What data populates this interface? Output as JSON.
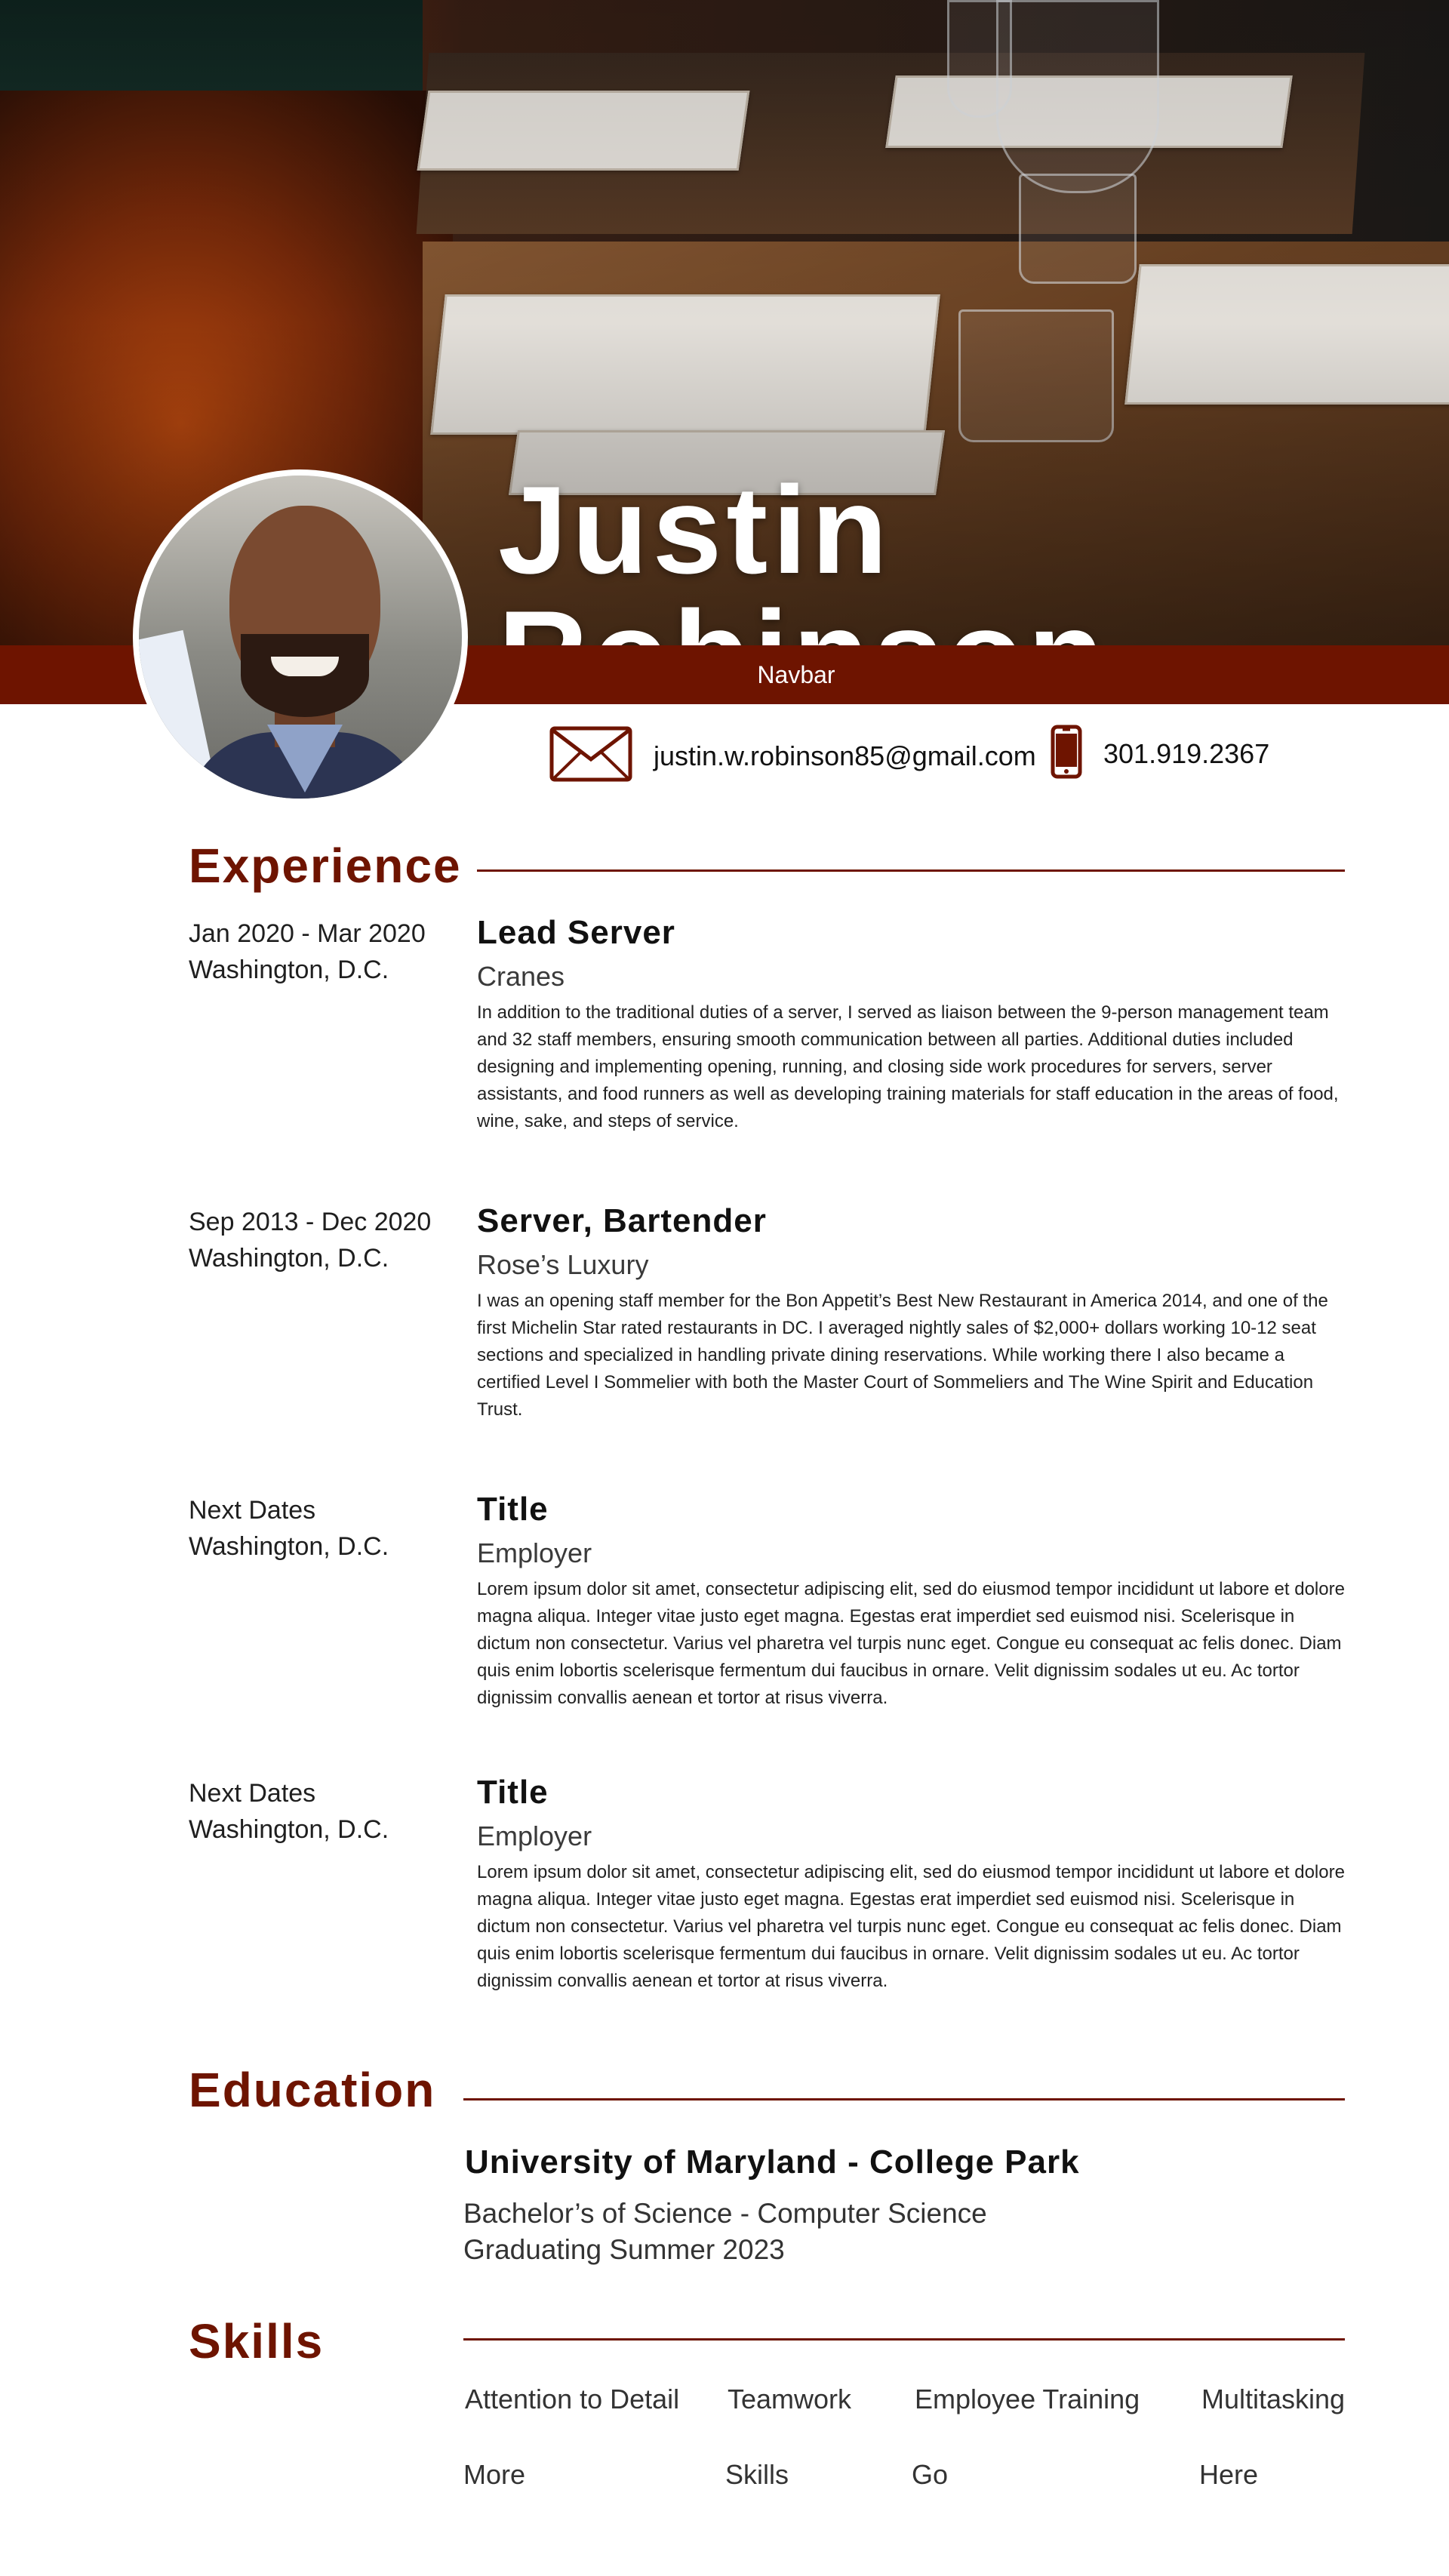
{
  "header": {
    "name": "Justin Robinson",
    "navbar_label": "Navbar"
  },
  "contact": {
    "email": "justin.w.robinson85@gmail.com",
    "phone": "301.919.2367",
    "email_icon": "envelope-icon",
    "phone_icon": "mobile-phone-icon"
  },
  "colors": {
    "accent": "#6e1400",
    "text": "#1a1a1a"
  },
  "experience": {
    "title": "Experience",
    "items": [
      {
        "dates": "Jan 2020 - Mar 2020",
        "location": "Washington, D.C.",
        "title": "Lead Server",
        "employer": "Cranes",
        "description": "In addition to the traditional duties of a server, I served as liaison between the 9-person management team and 32 staff members, ensuring smooth communication between all parties. Additional duties included designing and implementing opening, running, and closing side work procedures for servers, server assistants, and food runners as well as developing training materials for staff education in the areas of food, wine, sake, and steps of service."
      },
      {
        "dates": "Sep 2013 - Dec 2020",
        "location": "Washington, D.C.",
        "title": "Server, Bartender",
        "employer": "Rose’s Luxury",
        "description": "I was an opening staff member for the Bon Appetit’s Best New Restaurant in America 2014, and one of the first Michelin Star rated restaurants in DC. I averaged nightly sales of $2,000+ dollars working 10-12 seat sections and specialized in handling private dining reservations. While working there I also became a certified Level I Sommelier with both the Master Court of Sommeliers and The Wine Spirit and Education Trust."
      },
      {
        "dates": "Next Dates",
        "location": "Washington, D.C.",
        "title": "Title",
        "employer": "Employer",
        "description": "Lorem ipsum dolor sit amet, consectetur adipiscing elit, sed do eiusmod tempor incididunt ut labore et dolore magna aliqua. Integer vitae justo eget magna. Egestas erat imperdiet sed euismod nisi. Scelerisque in dictum non consectetur. Varius vel pharetra vel turpis nunc eget. Congue eu consequat ac felis donec. Diam quis enim lobortis scelerisque fermentum dui faucibus in ornare. Velit dignissim sodales ut eu. Ac tortor dignissim convallis aenean et tortor at risus viverra."
      },
      {
        "dates": "Next Dates",
        "location": "Washington, D.C.",
        "title": "Title",
        "employer": "Employer",
        "description": "Lorem ipsum dolor sit amet, consectetur adipiscing elit, sed do eiusmod tempor incididunt ut labore et dolore magna aliqua. Integer vitae justo eget magna. Egestas erat imperdiet sed euismod nisi. Scelerisque in dictum non consectetur. Varius vel pharetra vel turpis nunc eget. Congue eu consequat ac felis donec. Diam quis enim lobortis scelerisque fermentum dui faucibus in ornare. Velit dignissim sodales ut eu. Ac tortor dignissim convallis aenean et tortor at risus viverra."
      }
    ]
  },
  "education": {
    "title": "Education",
    "school": "University of Maryland - College Park",
    "degree": "Bachelor’s of Science - Computer Science",
    "graduation": "Graduating Summer 2023"
  },
  "skills": {
    "title": "Skills",
    "items": [
      "Attention to Detail",
      "Teamwork",
      "Employee Training",
      "Multitasking",
      "More",
      "Skills",
      "Go",
      "Here"
    ]
  }
}
